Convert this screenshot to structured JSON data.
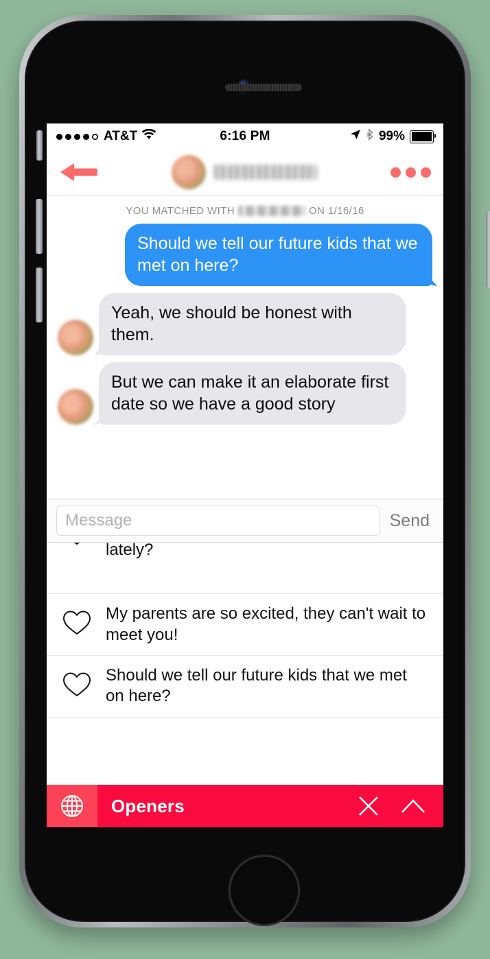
{
  "device": {
    "name": "iphone-6s-space-gray",
    "buttons": [
      "silent-switch",
      "volume-up",
      "volume-down",
      "power"
    ]
  },
  "status_bar": {
    "signal_bars_filled": 4,
    "signal_bars_total": 5,
    "carrier": "AT&T",
    "wifi_icon": "wifi-icon",
    "time": "6:16 PM",
    "location_icon": "location-arrow-icon",
    "bluetooth_icon": "bluetooth-icon",
    "battery_percent": "99%",
    "battery_level": 99
  },
  "nav_bar": {
    "back_icon": "back-arrow-icon",
    "match_name": "[redacted]",
    "avatar": "match-avatar",
    "menu_icon": "more-options-icon",
    "accent_color": "#fb6b6b"
  },
  "conversation": {
    "matched_prefix": "YOU MATCHED WITH",
    "matched_name": "[redacted]",
    "matched_suffix": "ON 1/16/16",
    "messages": [
      {
        "direction": "outgoing",
        "text": "Should we tell our future kids that we met on here?",
        "bubble_color": "#2e93f7",
        "text_color": "#ffffff"
      },
      {
        "direction": "incoming",
        "text": "Yeah, we should be honest with them.",
        "bubble_color": "#e6e6eb",
        "text_color": "#0d0d0d"
      },
      {
        "direction": "incoming",
        "text": "But we can make it an elaborate first date so we have a good story",
        "bubble_color": "#e6e6eb",
        "text_color": "#0d0d0d"
      }
    ]
  },
  "input_bar": {
    "placeholder": "Message",
    "value": "",
    "send_label": "Send"
  },
  "suggestions": {
    "items": [
      {
        "icon": "heart-outline-icon",
        "text": "lately?",
        "clipped": true
      },
      {
        "icon": "heart-outline-icon",
        "text": "My parents are so excited, they can't wait to meet you!",
        "clipped": false
      },
      {
        "icon": "heart-outline-icon",
        "text": "Should we tell our future kids that we met on here?",
        "clipped": false
      }
    ]
  },
  "openers_bar": {
    "globe_icon": "globe-icon",
    "label": "Openers",
    "close_icon": "close-icon",
    "collapse_icon": "chevron-up-icon",
    "background_color": "#fa0b3f",
    "globe_background_color": "#fc4257"
  }
}
